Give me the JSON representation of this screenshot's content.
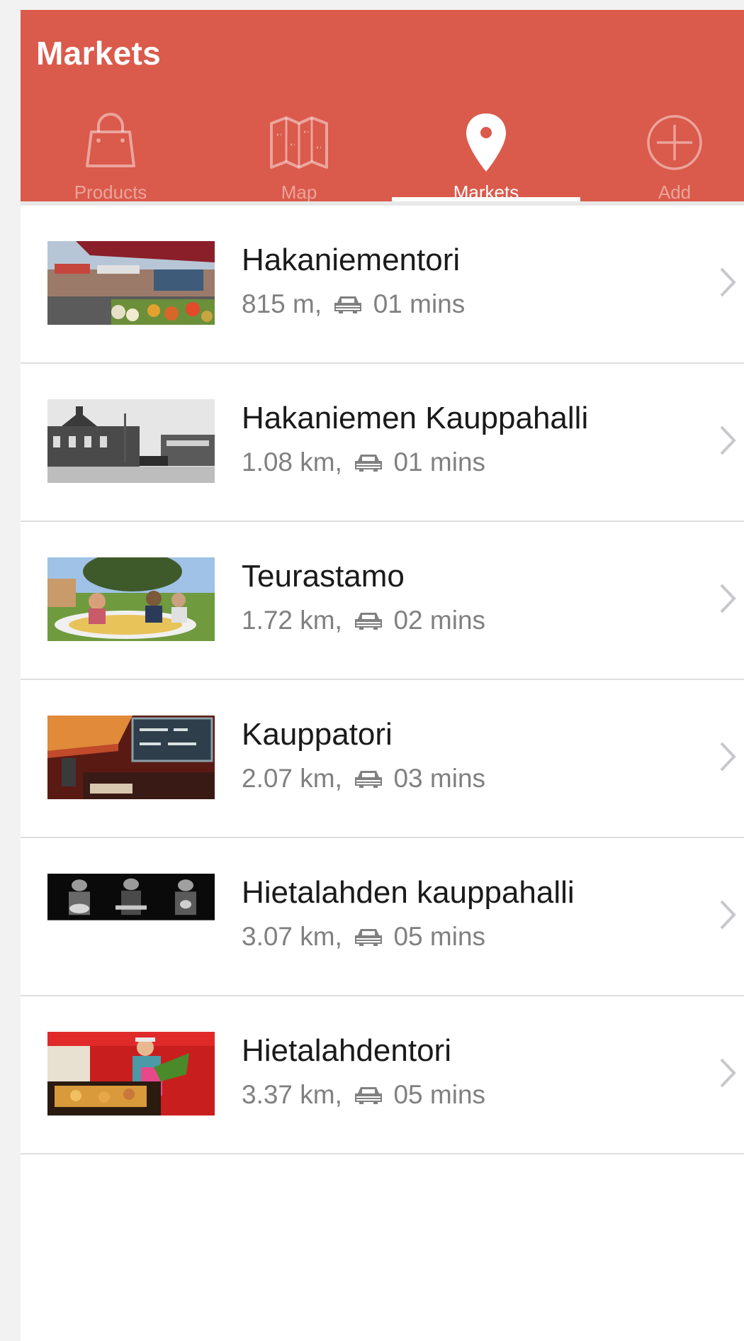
{
  "header": {
    "title": "Markets",
    "background_color": "#da5a4b"
  },
  "tabs": [
    {
      "label": "Products",
      "icon": "shopping-bag-icon",
      "active": false
    },
    {
      "label": "Map",
      "icon": "map-icon",
      "active": false
    },
    {
      "label": "Markets",
      "icon": "map-pin-icon",
      "active": true
    },
    {
      "label": "Add",
      "icon": "plus-circle-icon",
      "active": false
    }
  ],
  "markets": [
    {
      "name": "Hakaniementori",
      "distance": "815 m,",
      "drive_time": "01 mins"
    },
    {
      "name": "Hakaniemen Kauppahalli",
      "distance": "1.08 km,",
      "drive_time": "01 mins"
    },
    {
      "name": "Teurastamo",
      "distance": "1.72 km,",
      "drive_time": "02 mins"
    },
    {
      "name": "Kauppatori",
      "distance": "2.07 km,",
      "drive_time": "03 mins"
    },
    {
      "name": "Hietalahden kauppahalli",
      "distance": "3.07 km,",
      "drive_time": "05 mins"
    },
    {
      "name": "Hietalahdentori",
      "distance": "3.37 km,",
      "drive_time": "05 mins"
    }
  ],
  "icons": {
    "row_meta": "car-icon",
    "row_action": "chevron-right-icon"
  }
}
